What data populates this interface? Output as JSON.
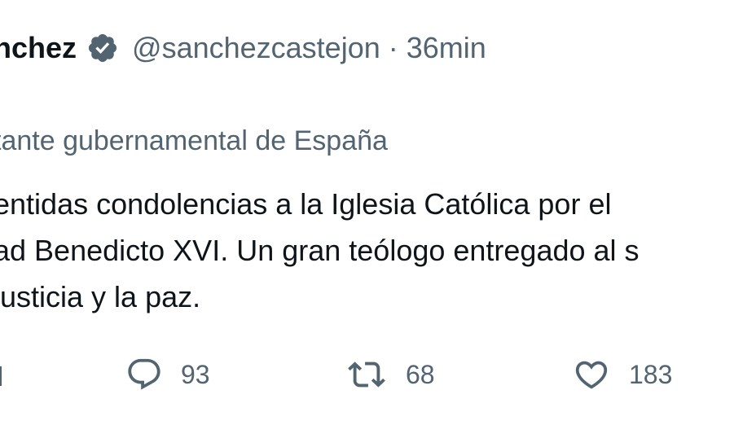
{
  "tweet": {
    "author_name": "nchez",
    "handle": "@sanchezcastejon",
    "separator": "·",
    "time": "36min",
    "account_label": "tante gubernamental de España",
    "body_lines": [
      "entidas condolencias a la Iglesia Católica por el",
      "ad Benedicto XVI. Un gran teólogo entregado al s",
      "justicia y la paz."
    ]
  },
  "actions": {
    "partial_icon": "chart-icon",
    "reply": {
      "icon": "reply-icon",
      "count": "93"
    },
    "retweet": {
      "icon": "retweet-icon",
      "count": "68"
    },
    "like": {
      "icon": "heart-icon",
      "count": "183"
    }
  },
  "colors": {
    "text": "#0f1419",
    "secondary": "#536471",
    "verified": "#536471",
    "background": "#ffffff"
  }
}
